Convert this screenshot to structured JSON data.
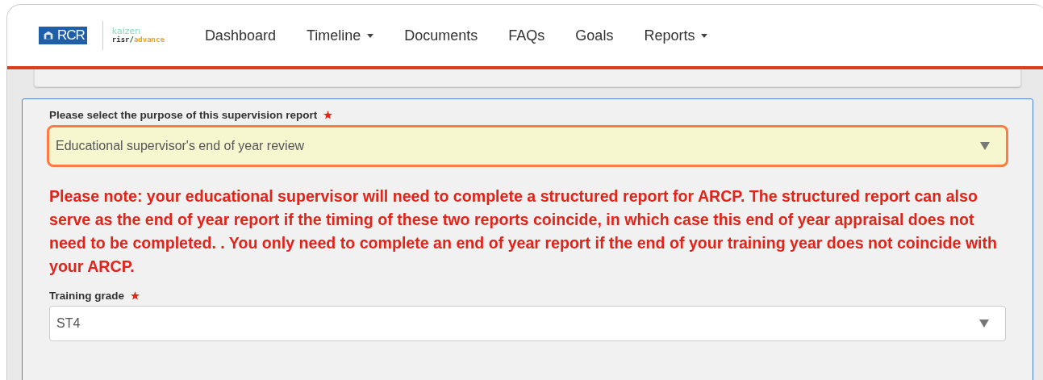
{
  "logo": {
    "crest_text": "RCR",
    "product": "kaizen",
    "brand_prefix": "risr/",
    "brand_suffix": "advance"
  },
  "nav": [
    {
      "label": "Dashboard",
      "dropdown": false
    },
    {
      "label": "Timeline",
      "dropdown": true
    },
    {
      "label": "Documents",
      "dropdown": false
    },
    {
      "label": "FAQs",
      "dropdown": false
    },
    {
      "label": "Goals",
      "dropdown": false
    },
    {
      "label": "Reports",
      "dropdown": true
    }
  ],
  "form": {
    "fields": [
      {
        "label": "Please select the purpose of this supervision report",
        "required": true,
        "value": "Educational supervisor's end of year review",
        "highlighted": true,
        "note": "Please note: your educational supervisor will need to complete a structured report for ARCP. The structured report can also serve as the end of year report if the timing of these two reports coincide, in which case this end of year appraisal does not need to be completed. . You only need to complete an end of year report if the end of your training year does not coincide with your ARCP."
      },
      {
        "label": "Training grade",
        "required": true,
        "value": "ST4",
        "highlighted": false
      }
    ]
  }
}
